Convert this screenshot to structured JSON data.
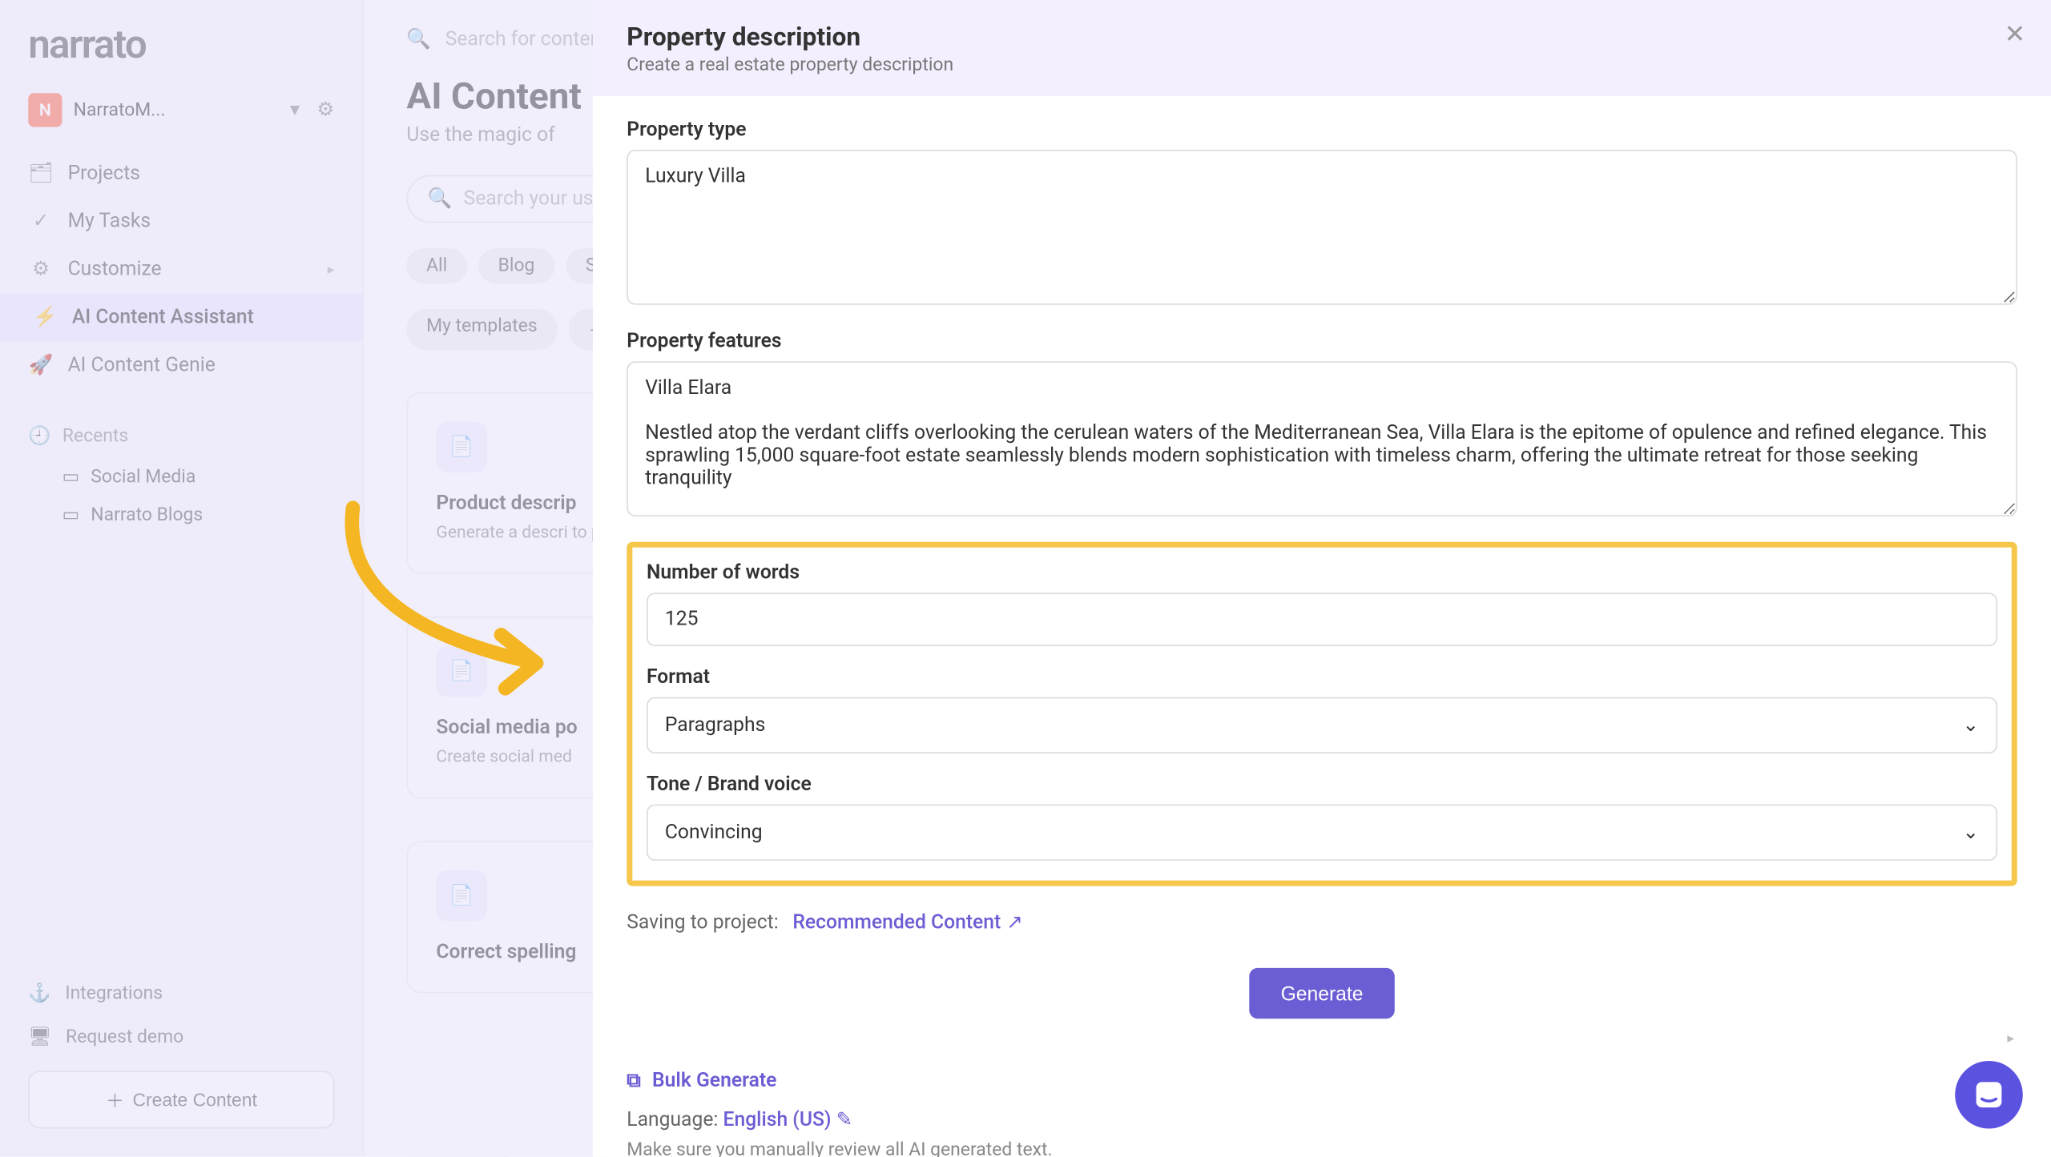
{
  "logo": "narrato",
  "workspace": {
    "avatar": "N",
    "name": "NarratoM..."
  },
  "nav": {
    "projects": "Projects",
    "tasks": "My Tasks",
    "customize": "Customize",
    "ai_assistant": "AI Content Assistant",
    "ai_genie": "AI Content Genie"
  },
  "recents": {
    "header": "Recents",
    "items": [
      "Social Media",
      "Narrato Blogs"
    ]
  },
  "sidebar_bottom": {
    "integrations": "Integrations",
    "request_demo": "Request demo",
    "create_content": "Create Content"
  },
  "main": {
    "search_placeholder": "Search for content",
    "title": "AI Content",
    "subtitle": "Use the magic of",
    "use_search_placeholder": "Search your use",
    "chips": [
      "All",
      "Blog",
      "S"
    ],
    "chips_row2": [
      "My templates"
    ],
    "cards": [
      {
        "title": "Product descrip",
        "desc": "Generate a descri to product and featur"
      },
      {
        "title": "Social media po",
        "desc": "Create social med"
      },
      {
        "title": "Correct spelling",
        "desc": ""
      }
    ]
  },
  "modal": {
    "title": "Property description",
    "subtitle": "Create a real estate property description",
    "property_type_label": "Property type",
    "property_type_value": "Luxury Villa",
    "property_features_label": "Property features",
    "property_features_value": "Villa Elara\n\nNestled atop the verdant cliffs overlooking the cerulean waters of the Mediterranean Sea, Villa Elara is the epitome of opulence and refined elegance. This sprawling 15,000 square-foot estate seamlessly blends modern sophistication with timeless charm, offering the ultimate retreat for those seeking tranquility",
    "words_label": "Number of words",
    "words_value": "125",
    "format_label": "Format",
    "format_value": "Paragraphs",
    "tone_label": "Tone / Brand voice",
    "tone_value": "Convincing",
    "saving_label": "Saving to project:",
    "saving_project": "Recommended Content",
    "generate": "Generate",
    "bulk_generate": "Bulk Generate",
    "language_label": "Language:",
    "language_value": "English (US)",
    "disclaimer": "Make sure you manually review all AI generated text."
  }
}
